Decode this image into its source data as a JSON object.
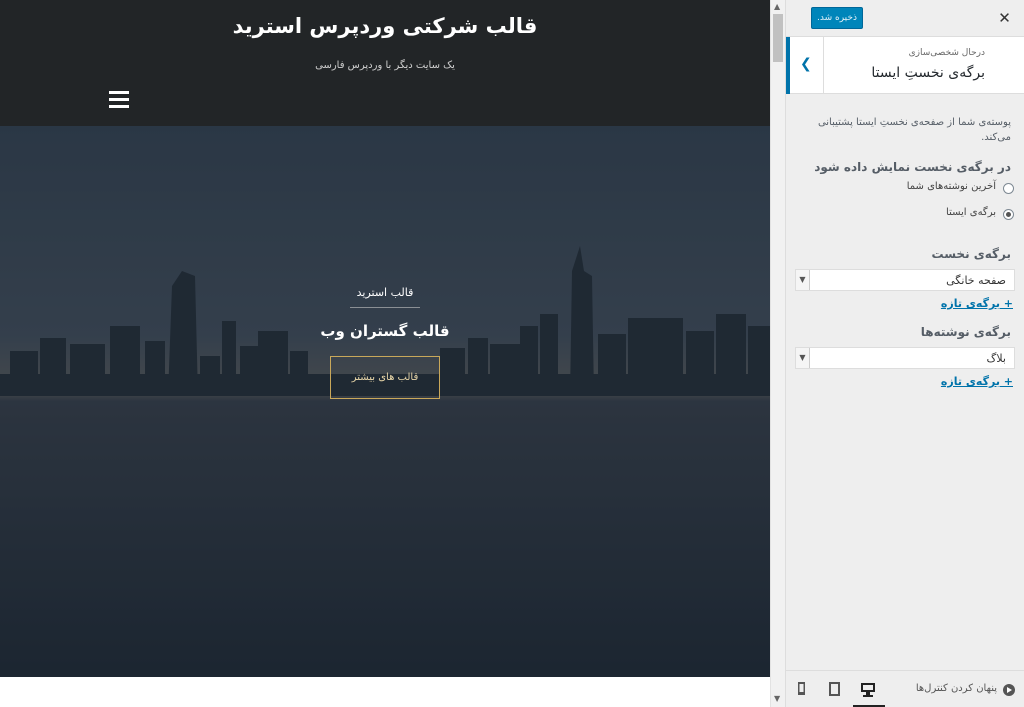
{
  "site": {
    "title": "قالب شرکتی وردپرس استرید",
    "tagline": "یک سایت دیگر با وردپرس فارسی"
  },
  "hero": {
    "kicker": "قالب استرید",
    "heading": "قالب گستران وب",
    "button_label": "قالب های بیشتر"
  },
  "customizer": {
    "save_label": "ذخیره شد.",
    "close_symbol": "✕",
    "breadcrumb": "درحال شخصی‌سازی",
    "section_title": "برگه‌ی نخستِ ایستا",
    "description": "پوسته‌ی شما از صفحه‌ی نخستِ ایستا پشتیبانی می‌کند.",
    "show_label": "در برگه‌ی نخست نمایش داده شود",
    "options": {
      "latest_posts": "آخرین نوشته‌های شما",
      "static_page": "برگه‌ی ایستا",
      "selected": "static_page"
    },
    "front_page_label": "برگه‌ی نخست",
    "front_page_value": "صفحه خانگی",
    "posts_page_label": "برگه‌ی نوشته‌ها",
    "posts_page_value": "بلاگ",
    "add_new_page": "+ برگه‌ی تازه",
    "hide_controls": "پنهان کردن کنترل‌ها"
  },
  "colors": {
    "header_bg": "#222527",
    "accent_blue": "#0073aa",
    "save_button": "#0085ba",
    "hero_button_border": "#c9a85a"
  },
  "icons": {
    "menu": "hamburger-icon",
    "close": "close-icon",
    "back": "chevron-left-icon",
    "hide": "play-circle-icon",
    "desktop": "desktop-icon",
    "tablet": "tablet-icon",
    "mobile": "mobile-icon"
  }
}
